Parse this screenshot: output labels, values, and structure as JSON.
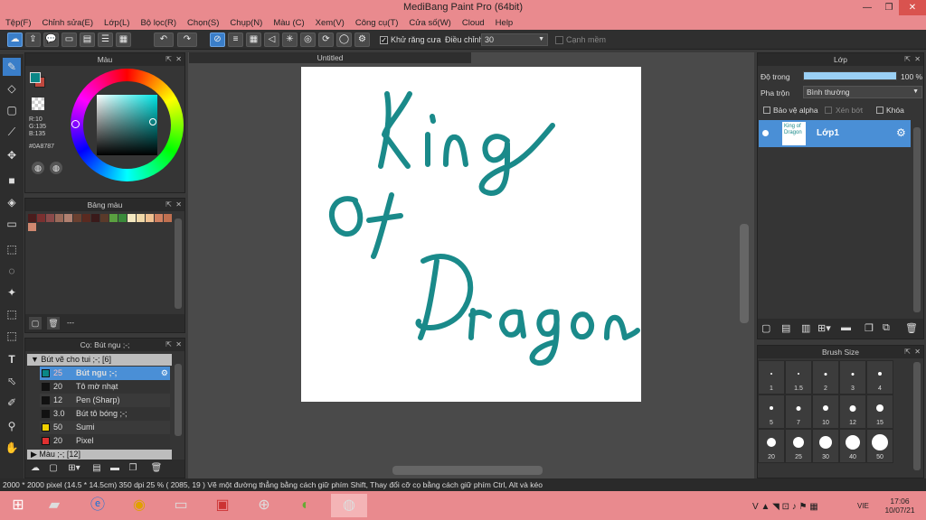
{
  "title_bar": {
    "title": "MediBang Paint Pro (64bit)"
  },
  "menu": [
    "Tệp(F)",
    "Chỉnh sửa(E)",
    "Lớp(L)",
    "Bộ lọc(R)",
    "Chọn(S)",
    "Chụp(N)",
    "Màu (C)",
    "Xem(V)",
    "Công cụ(T)",
    "Cửa số(W)",
    "Cloud",
    "Help"
  ],
  "toolbar": {
    "antialias_label": "Khử răng cưa",
    "adjust_label": "Điều chỉnh",
    "adjust_value": "30",
    "smooth_label": "Cạnh mềm"
  },
  "color_panel": {
    "title": "Màu",
    "r": "R:10",
    "g": "G:135",
    "b": "B:135",
    "hex": "#0A8787",
    "primary_color": "#0a8787",
    "secondary_color": "#c0483e"
  },
  "palette_panel": {
    "title": "Bảng màu",
    "footer_label": "---",
    "colors": [
      "#4a1c1c",
      "#7a3030",
      "#8a4a4a",
      "#9a6a5a",
      "#b08070",
      "#6a4030",
      "#5a2a20",
      "#3a1a1a",
      "#5a3a2a",
      "#5aa040",
      "#3a8a3a",
      "#f4e8c0",
      "#f0d8a8",
      "#f0c090",
      "#d08060",
      "#c07050"
    ]
  },
  "brush_panel": {
    "title": "Cọ: Bút ngu ;-;",
    "group_label": "Bút vẽ cho tui ;-; [6]",
    "items": [
      {
        "size": "25",
        "name": "Bút ngu ;-;",
        "color": "#0a8787",
        "selected": true
      },
      {
        "size": "20",
        "name": "Tô mờ nhạt",
        "color": "#111111",
        "selected": false
      },
      {
        "size": "12",
        "name": "Pen (Sharp)",
        "color": "#111111",
        "selected": false
      },
      {
        "size": "3.0",
        "name": "Bút tô bóng ;-;",
        "color": "#111111",
        "selected": false
      },
      {
        "size": "50",
        "name": "Sumi",
        "color": "#f0d000",
        "selected": false
      },
      {
        "size": "20",
        "name": "Pixel",
        "color": "#e03030",
        "selected": false
      }
    ],
    "group2_label": "Màu ;-; [12]"
  },
  "canvas": {
    "tab_title": "Untitled",
    "artwork_text": [
      "King",
      "of",
      "Dragon"
    ],
    "ink_color": "#1a8a8a"
  },
  "layer_panel": {
    "title": "Lớp",
    "opacity_label": "Độ trong",
    "opacity_value": "100 %",
    "opacity_fraction": 1.0,
    "blend_label": "Pha trộn",
    "blend_value": "Bình thường",
    "protect_alpha_label": "Bảo vệ alpha",
    "clip_label": "Xén bớt",
    "lock_label": "Khóa",
    "layer_name": "Lớp1",
    "thumb_text": "King of Dragon"
  },
  "brush_size_panel": {
    "title": "Brush Size",
    "sizes": [
      "1",
      "1.5",
      "2",
      "3",
      "4",
      "5",
      "7",
      "10",
      "12",
      "15",
      "20",
      "25",
      "30",
      "40",
      "50"
    ]
  },
  "status_bar": {
    "text": "2000 * 2000 pixel   (14.5 * 14.5cm)   350 dpi   25 %   ( 2085, 19 )   Vẽ một đường thẳng bằng cách giữ phím Shift, Thay đổi cỡ cọ bằng cách giữ phím Ctrl, Alt và kéo"
  },
  "taskbar": {
    "lang": "VIE",
    "time": "17:06",
    "date": "10/07/21"
  }
}
